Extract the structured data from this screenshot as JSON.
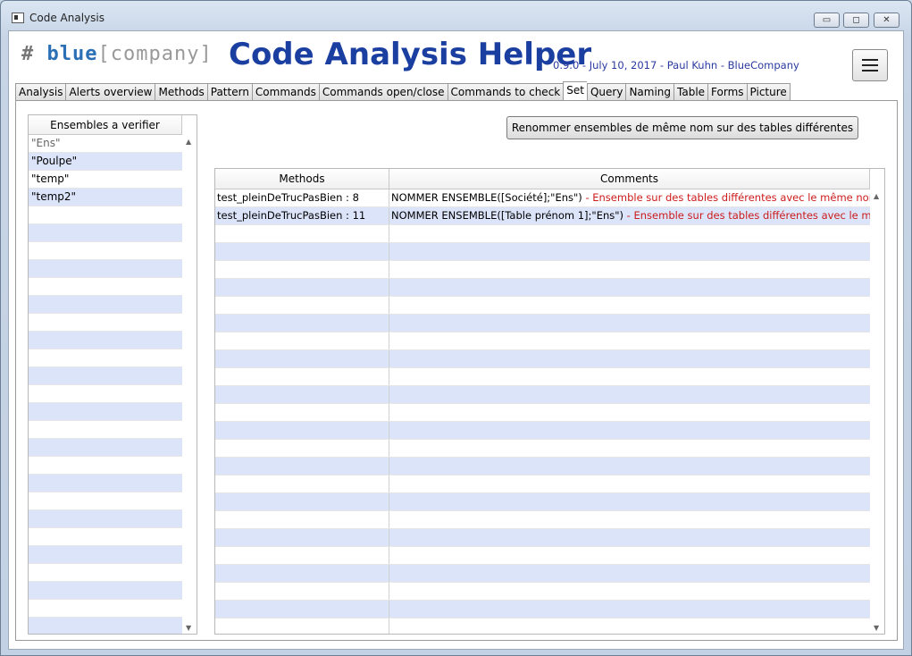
{
  "window": {
    "title": "Code Analysis",
    "controls": {
      "minimize": "▭",
      "maximize": "◻",
      "close": "✕"
    }
  },
  "header": {
    "logo_hash": "#",
    "logo_blue": "blue",
    "logo_company": "[company]",
    "app_title": "Code Analysis Helper",
    "version": "0.9.0 - July 10, 2017 - Paul Kuhn - BlueCompany",
    "menu_icon": "hamburger-icon"
  },
  "tabs": [
    {
      "label": "Analysis"
    },
    {
      "label": "Alerts overview"
    },
    {
      "label": "Methods"
    },
    {
      "label": "Pattern"
    },
    {
      "label": "Commands"
    },
    {
      "label": "Commands open/close"
    },
    {
      "label": "Commands to check"
    },
    {
      "label": "Set",
      "active": true
    },
    {
      "label": "Query"
    },
    {
      "label": "Naming"
    },
    {
      "label": "Table"
    },
    {
      "label": "Forms"
    },
    {
      "label": "Picture"
    }
  ],
  "sets_list": {
    "header": "Ensembles a verifier",
    "items": [
      "\"Ens\"",
      "\"Poulpe\"",
      "\"temp\"",
      "\"temp2\""
    ],
    "selected_index": 0
  },
  "rename_button": {
    "label": "Renommer ensembles de même nom sur des tables différentes"
  },
  "grid": {
    "columns": [
      "Methods",
      "Comments"
    ],
    "rows": [
      {
        "method": "test_pleinDeTrucPasBien : 8",
        "code": "NOMMER ENSEMBLE([Société];\"Ens\")",
        "warning": " - Ensemble sur des tables différentes avec le même nom"
      },
      {
        "method": "test_pleinDeTrucPasBien : 11",
        "code": "NOMMER ENSEMBLE([Table prénom 1];\"Ens\")",
        "warning": " - Ensemble sur des tables différentes avec le même ..."
      }
    ]
  }
}
